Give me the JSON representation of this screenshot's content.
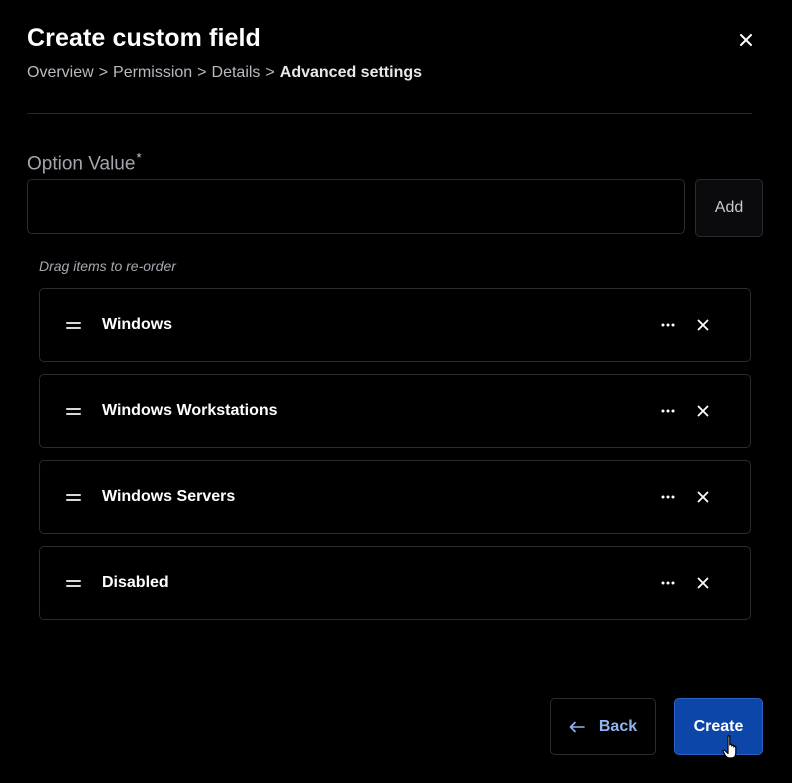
{
  "dialog": {
    "title": "Create custom field",
    "close_icon": "close-icon"
  },
  "breadcrumb": {
    "steps": [
      "Overview",
      "Permission",
      "Details",
      "Advanced settings"
    ],
    "separator": ">"
  },
  "option_field": {
    "label": "Option Value",
    "required_marker": "*",
    "value": "",
    "placeholder": "",
    "add_label": "Add"
  },
  "list": {
    "hint": "Drag items to re-order",
    "items": [
      {
        "label": "Windows"
      },
      {
        "label": "Windows Workstations"
      },
      {
        "label": "Windows Servers"
      },
      {
        "label": "Disabled"
      }
    ]
  },
  "footer": {
    "back_label": "Back",
    "create_label": "Create"
  },
  "colors": {
    "background": "#000000",
    "primary": "#0b46a8",
    "link": "#8fb6f2",
    "border": "#2b2b31"
  }
}
